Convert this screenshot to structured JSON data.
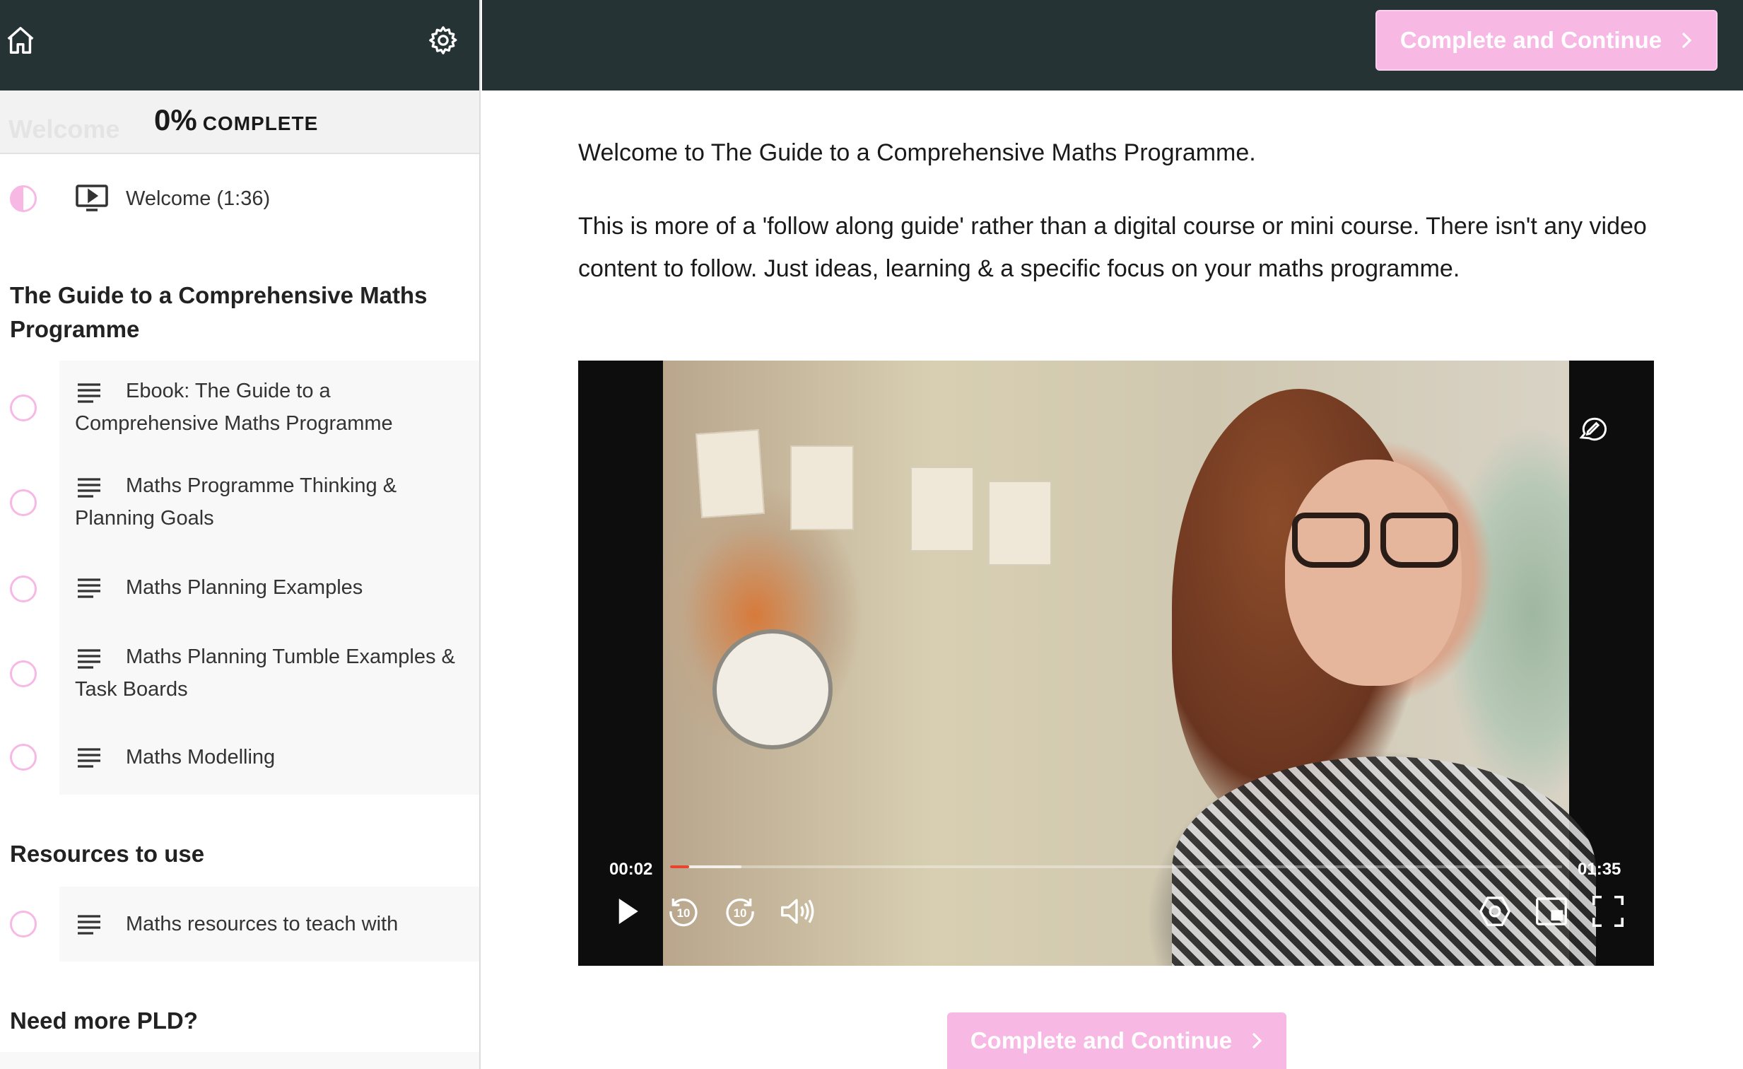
{
  "sidebar": {
    "progress_percent": "0%",
    "progress_label": "COMPLETE",
    "progress_ghost": "Welcome",
    "welcome_item": {
      "label": "Welcome (1:36)",
      "status": "in-progress",
      "icon": "video-icon"
    },
    "sections": [
      {
        "title": "The Guide to a Comprehensive Maths Programme",
        "items": [
          {
            "label": "Ebook: The Guide to a Comprehensive Maths Programme",
            "icon": "text-lines-icon"
          },
          {
            "label": "Maths Programme Thinking & Planning Goals",
            "icon": "text-lines-icon"
          },
          {
            "label": "Maths Planning Examples",
            "icon": "text-lines-icon"
          },
          {
            "label": "Maths Planning Tumble Examples & Task Boards",
            "icon": "text-lines-icon"
          },
          {
            "label": "Maths Modelling",
            "icon": "text-lines-icon"
          }
        ]
      },
      {
        "title": "Resources to use",
        "items": [
          {
            "label": "Maths resources to teach with",
            "icon": "text-lines-icon"
          }
        ]
      },
      {
        "title": "Need more PLD?",
        "items": []
      }
    ]
  },
  "header": {
    "complete_button_label": "Complete and Continue"
  },
  "main": {
    "paragraphs": [
      "Welcome to The Guide to a Comprehensive Maths Programme.",
      "This is more of a 'follow along guide' rather than a digital course or mini course. There isn't any video content to follow. Just ideas, learning & a specific focus on your maths programme."
    ],
    "video": {
      "current_time": "00:02",
      "duration": "01:35",
      "progress_fraction": 0.021,
      "buffered_fraction": 0.08
    },
    "complete_button_label": "Complete and Continue"
  },
  "colors": {
    "header_bg": "#263335",
    "accent_pink": "#f7b8e4",
    "progress_red": "#e8442e"
  }
}
